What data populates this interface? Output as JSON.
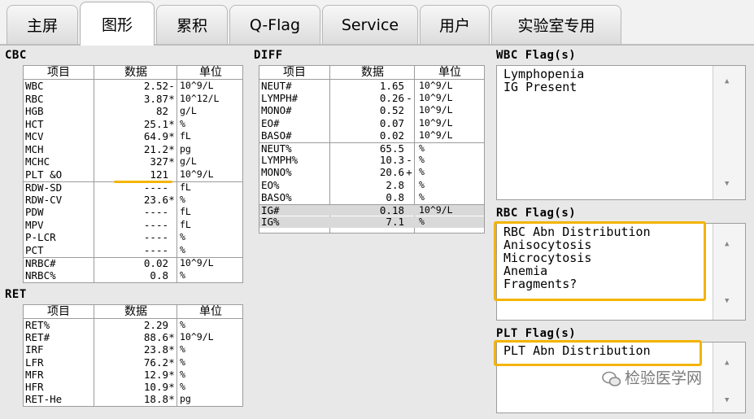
{
  "tabs": [
    "主屏",
    "图形",
    "累积",
    "Q-Flag",
    "Service",
    "用户",
    "实验室专用"
  ],
  "active_tab": "图形",
  "headers": {
    "item": "项目",
    "data": "数据",
    "unit": "单位"
  },
  "cbc": {
    "title": "CBC",
    "rows": [
      {
        "name": "WBC",
        "value": "2.52",
        "flag": "-",
        "unit": "10^9/L"
      },
      {
        "name": "RBC",
        "value": "3.87",
        "flag": "*",
        "unit": "10^12/L"
      },
      {
        "name": "HGB",
        "value": "82",
        "flag": "",
        "unit": "g/L"
      },
      {
        "name": "HCT",
        "value": "25.1",
        "flag": "*",
        "unit": "%"
      },
      {
        "name": "MCV",
        "value": "64.9",
        "flag": "*",
        "unit": "fL"
      },
      {
        "name": "MCH",
        "value": "21.2",
        "flag": "*",
        "unit": "pg"
      },
      {
        "name": "MCHC",
        "value": "327",
        "flag": "*",
        "unit": "g/L"
      },
      {
        "name": "PLT &O",
        "value": "121",
        "flag": "",
        "unit": "10^9/L"
      },
      {
        "name": "RDW-SD",
        "value": "----",
        "flag": "",
        "unit": "fL"
      },
      {
        "name": "RDW-CV",
        "value": "23.6",
        "flag": "*",
        "unit": "%"
      },
      {
        "name": "PDW",
        "value": "----",
        "flag": "",
        "unit": "fL"
      },
      {
        "name": "MPV",
        "value": "----",
        "flag": "",
        "unit": "fL"
      },
      {
        "name": "P-LCR",
        "value": "----",
        "flag": "",
        "unit": "%"
      },
      {
        "name": "PCT",
        "value": "----",
        "flag": "",
        "unit": "%"
      },
      {
        "name": "NRBC#",
        "value": "0.02",
        "flag": "",
        "unit": "10^9/L"
      },
      {
        "name": "NRBC%",
        "value": "0.8",
        "flag": "",
        "unit": "%"
      }
    ]
  },
  "diff": {
    "title": "DIFF",
    "rows": [
      {
        "name": "NEUT#",
        "value": "1.65",
        "flag": "",
        "unit": "10^9/L"
      },
      {
        "name": "LYMPH#",
        "value": "0.26",
        "flag": "-",
        "unit": "10^9/L"
      },
      {
        "name": "MONO#",
        "value": "0.52",
        "flag": "",
        "unit": "10^9/L"
      },
      {
        "name": "EO#",
        "value": "0.07",
        "flag": "",
        "unit": "10^9/L"
      },
      {
        "name": "BASO#",
        "value": "0.02",
        "flag": "",
        "unit": "10^9/L"
      },
      {
        "name": "NEUT%",
        "value": "65.5",
        "flag": "",
        "unit": "%"
      },
      {
        "name": "LYMPH%",
        "value": "10.3",
        "flag": "-",
        "unit": "%"
      },
      {
        "name": "MONO%",
        "value": "20.6",
        "flag": "+",
        "unit": "%"
      },
      {
        "name": "EO%",
        "value": "2.8",
        "flag": "",
        "unit": "%"
      },
      {
        "name": "BASO%",
        "value": "0.8",
        "flag": "",
        "unit": "%"
      },
      {
        "name": "IG#",
        "value": "0.18",
        "flag": "",
        "unit": "10^9/L"
      },
      {
        "name": "IG%",
        "value": "7.1",
        "flag": "",
        "unit": "%"
      }
    ]
  },
  "ret": {
    "title": "RET",
    "rows": [
      {
        "name": "RET%",
        "value": "2.29",
        "flag": "",
        "unit": "%"
      },
      {
        "name": "RET#",
        "value": "88.6",
        "flag": "*",
        "unit": "10^9/L"
      },
      {
        "name": "IRF",
        "value": "23.8",
        "flag": "*",
        "unit": "%"
      },
      {
        "name": "LFR",
        "value": "76.2",
        "flag": "*",
        "unit": "%"
      },
      {
        "name": "MFR",
        "value": "12.9",
        "flag": "*",
        "unit": "%"
      },
      {
        "name": "HFR",
        "value": "10.9",
        "flag": "*",
        "unit": "%"
      },
      {
        "name": "RET-He",
        "value": "18.8",
        "flag": "*",
        "unit": "pg"
      }
    ]
  },
  "wbc_flags": {
    "title": "WBC Flag(s)",
    "text": "Lymphopenia\nIG Present"
  },
  "rbc_flags": {
    "title": "RBC Flag(s)",
    "text": "RBC Abn Distribution\nAnisocytosis\nMicrocytosis\nAnemia\nFragments?"
  },
  "plt_flags": {
    "title": "PLT Flag(s)",
    "text": "PLT Abn Distribution"
  },
  "watermark": "检验医学网",
  "colors": {
    "highlight": "#f4b400",
    "shaded_row": "#d9d9d9"
  }
}
